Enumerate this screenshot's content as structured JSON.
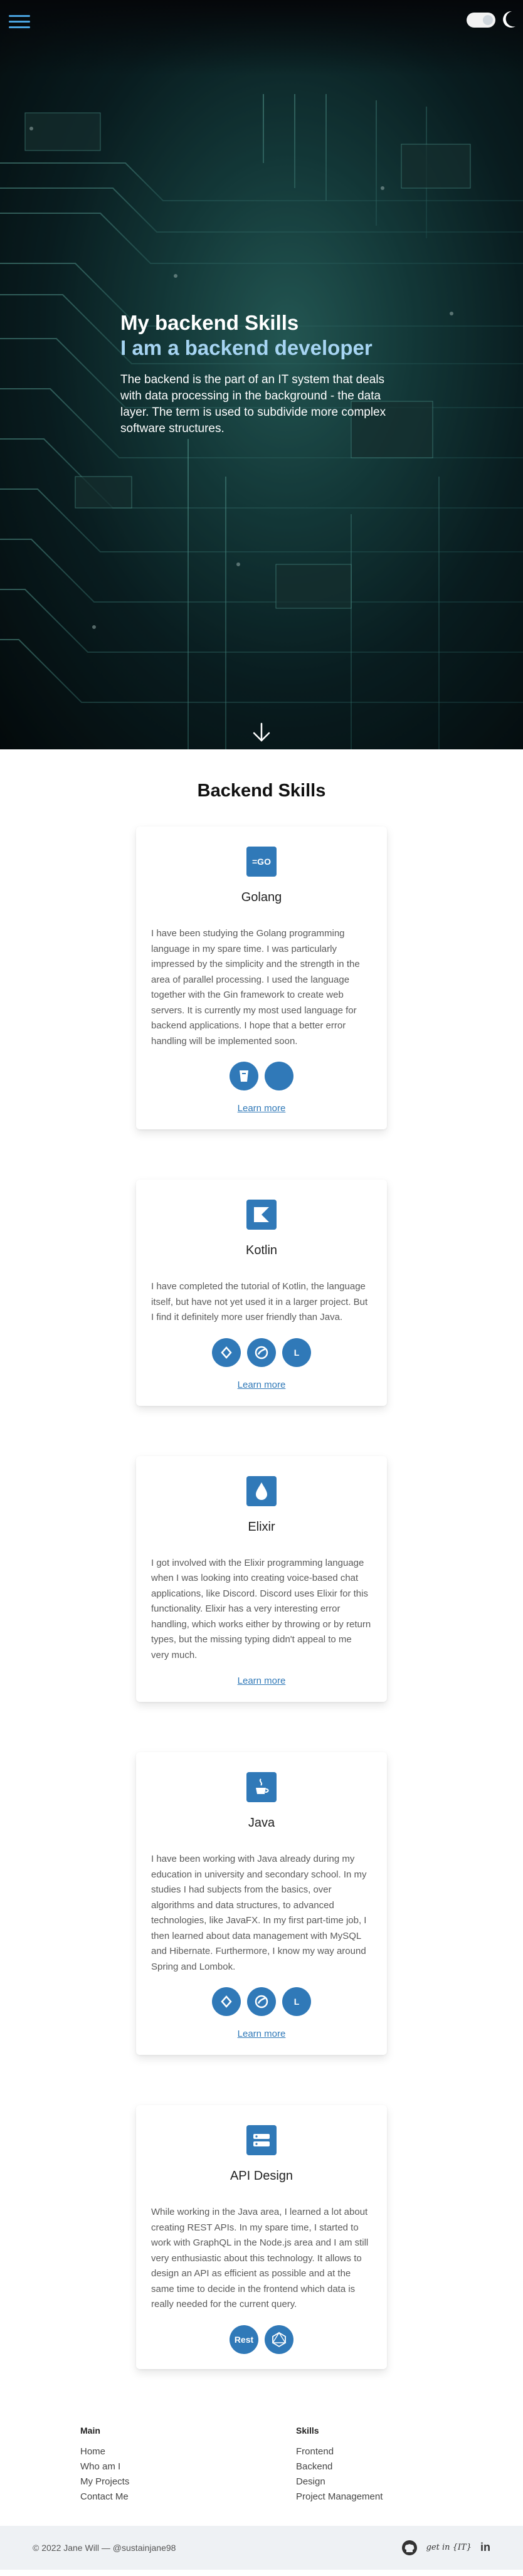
{
  "header": {
    "menu_icon": "hamburger-menu-icon",
    "theme_toggle_icon": "toggle-switch-icon",
    "moon_icon": "moon-icon"
  },
  "hero": {
    "title": "My backend Skills",
    "subtitle": "I am a backend developer",
    "description": "The backend is the part of an IT system that deals with data processing in the background - the data layer. The term is used to subdivide more complex software structures.",
    "scroll_icon": "arrow-down-icon"
  },
  "skills": {
    "section_title": "Backend Skills",
    "cards": [
      {
        "icon": "golang-gopher-icon",
        "title": "Golang",
        "text": "I have been studying the Golang programming language in my spare time. I was particularly impressed by the simplicity and the strength in the area of parallel processing. I used the language together with the Gin framework to create web servers. It is currently my most used language for backend applications. I hope that a better error handling will be implemented soon.",
        "badges": [
          "",
          ""
        ],
        "badge_icons": [
          "gin-icon",
          "badge-icon"
        ],
        "link": "Learn more"
      },
      {
        "icon": "kotlin-icon",
        "title": "Kotlin",
        "text": "I have completed the tutorial of Kotlin, the language itself, but have not yet used it in a larger project. But I find it definitely more user friendly than Java.",
        "badges": [
          "",
          "",
          "L"
        ],
        "badge_icons": [
          "hibernate-icon",
          "spring-icon",
          "lombok-icon"
        ],
        "link": "Learn more"
      },
      {
        "icon": "elixir-drop-icon",
        "title": "Elixir",
        "text": "I got involved with the Elixir programming language when I was looking into creating voice-based chat applications, like Discord. Discord uses Elixir for this functionality. Elixir has a very interesting error handling, which works either by throwing or by return types, but the missing typing didn't appeal to me very much.",
        "badges": [],
        "badge_icons": [],
        "link": "Learn more"
      },
      {
        "icon": "java-cup-icon",
        "title": "Java",
        "text": "I have been working with Java already during my education in university and secondary school. In my studies I had subjects from the basics, over algorithms and data structures, to advanced technologies, like JavaFX. In my first part-time job, I then learned about data management with MySQL and Hibernate. Furthermore, I know my way around Spring and Lombok.",
        "badges": [
          "",
          "",
          "L"
        ],
        "badge_icons": [
          "hibernate-icon",
          "spring-icon",
          "lombok-icon"
        ],
        "link": "Learn more"
      },
      {
        "icon": "api-server-icon",
        "title": "API Design",
        "text": "While working in the Java area, I learned a lot about creating REST APIs. In my spare time, I started to work with GraphQL in the Node.js area and I am still very enthusiastic about this technology. It allows to design an API as efficient as possible and at the same time to decide in the frontend which data is really needed for the current query.",
        "badges": [
          "Rest",
          ""
        ],
        "badge_icons": [
          "rest-icon",
          "graphql-icon"
        ],
        "link": ""
      }
    ]
  },
  "footer": {
    "col1": {
      "heading": "Main",
      "links": [
        "Home",
        "Who am I",
        "My Projects",
        "Contact Me"
      ]
    },
    "col2": {
      "heading": "Skills",
      "links": [
        "Frontend",
        "Backend",
        "Design",
        "Project Management"
      ]
    },
    "copyright": "© 2022 Jane Will — @sustainjane98",
    "social": {
      "github_icon": "github-icon",
      "get_in_it_icon": "get-in-it-logo-icon",
      "get_in_it_text": "get in {IT}",
      "linkedin_icon": "linkedin-icon",
      "linkedin_text": "in"
    }
  },
  "colors": {
    "accent": "#3079b8",
    "hero_subtitle": "#a6d4f2",
    "footer_bg": "#eef1f4"
  }
}
